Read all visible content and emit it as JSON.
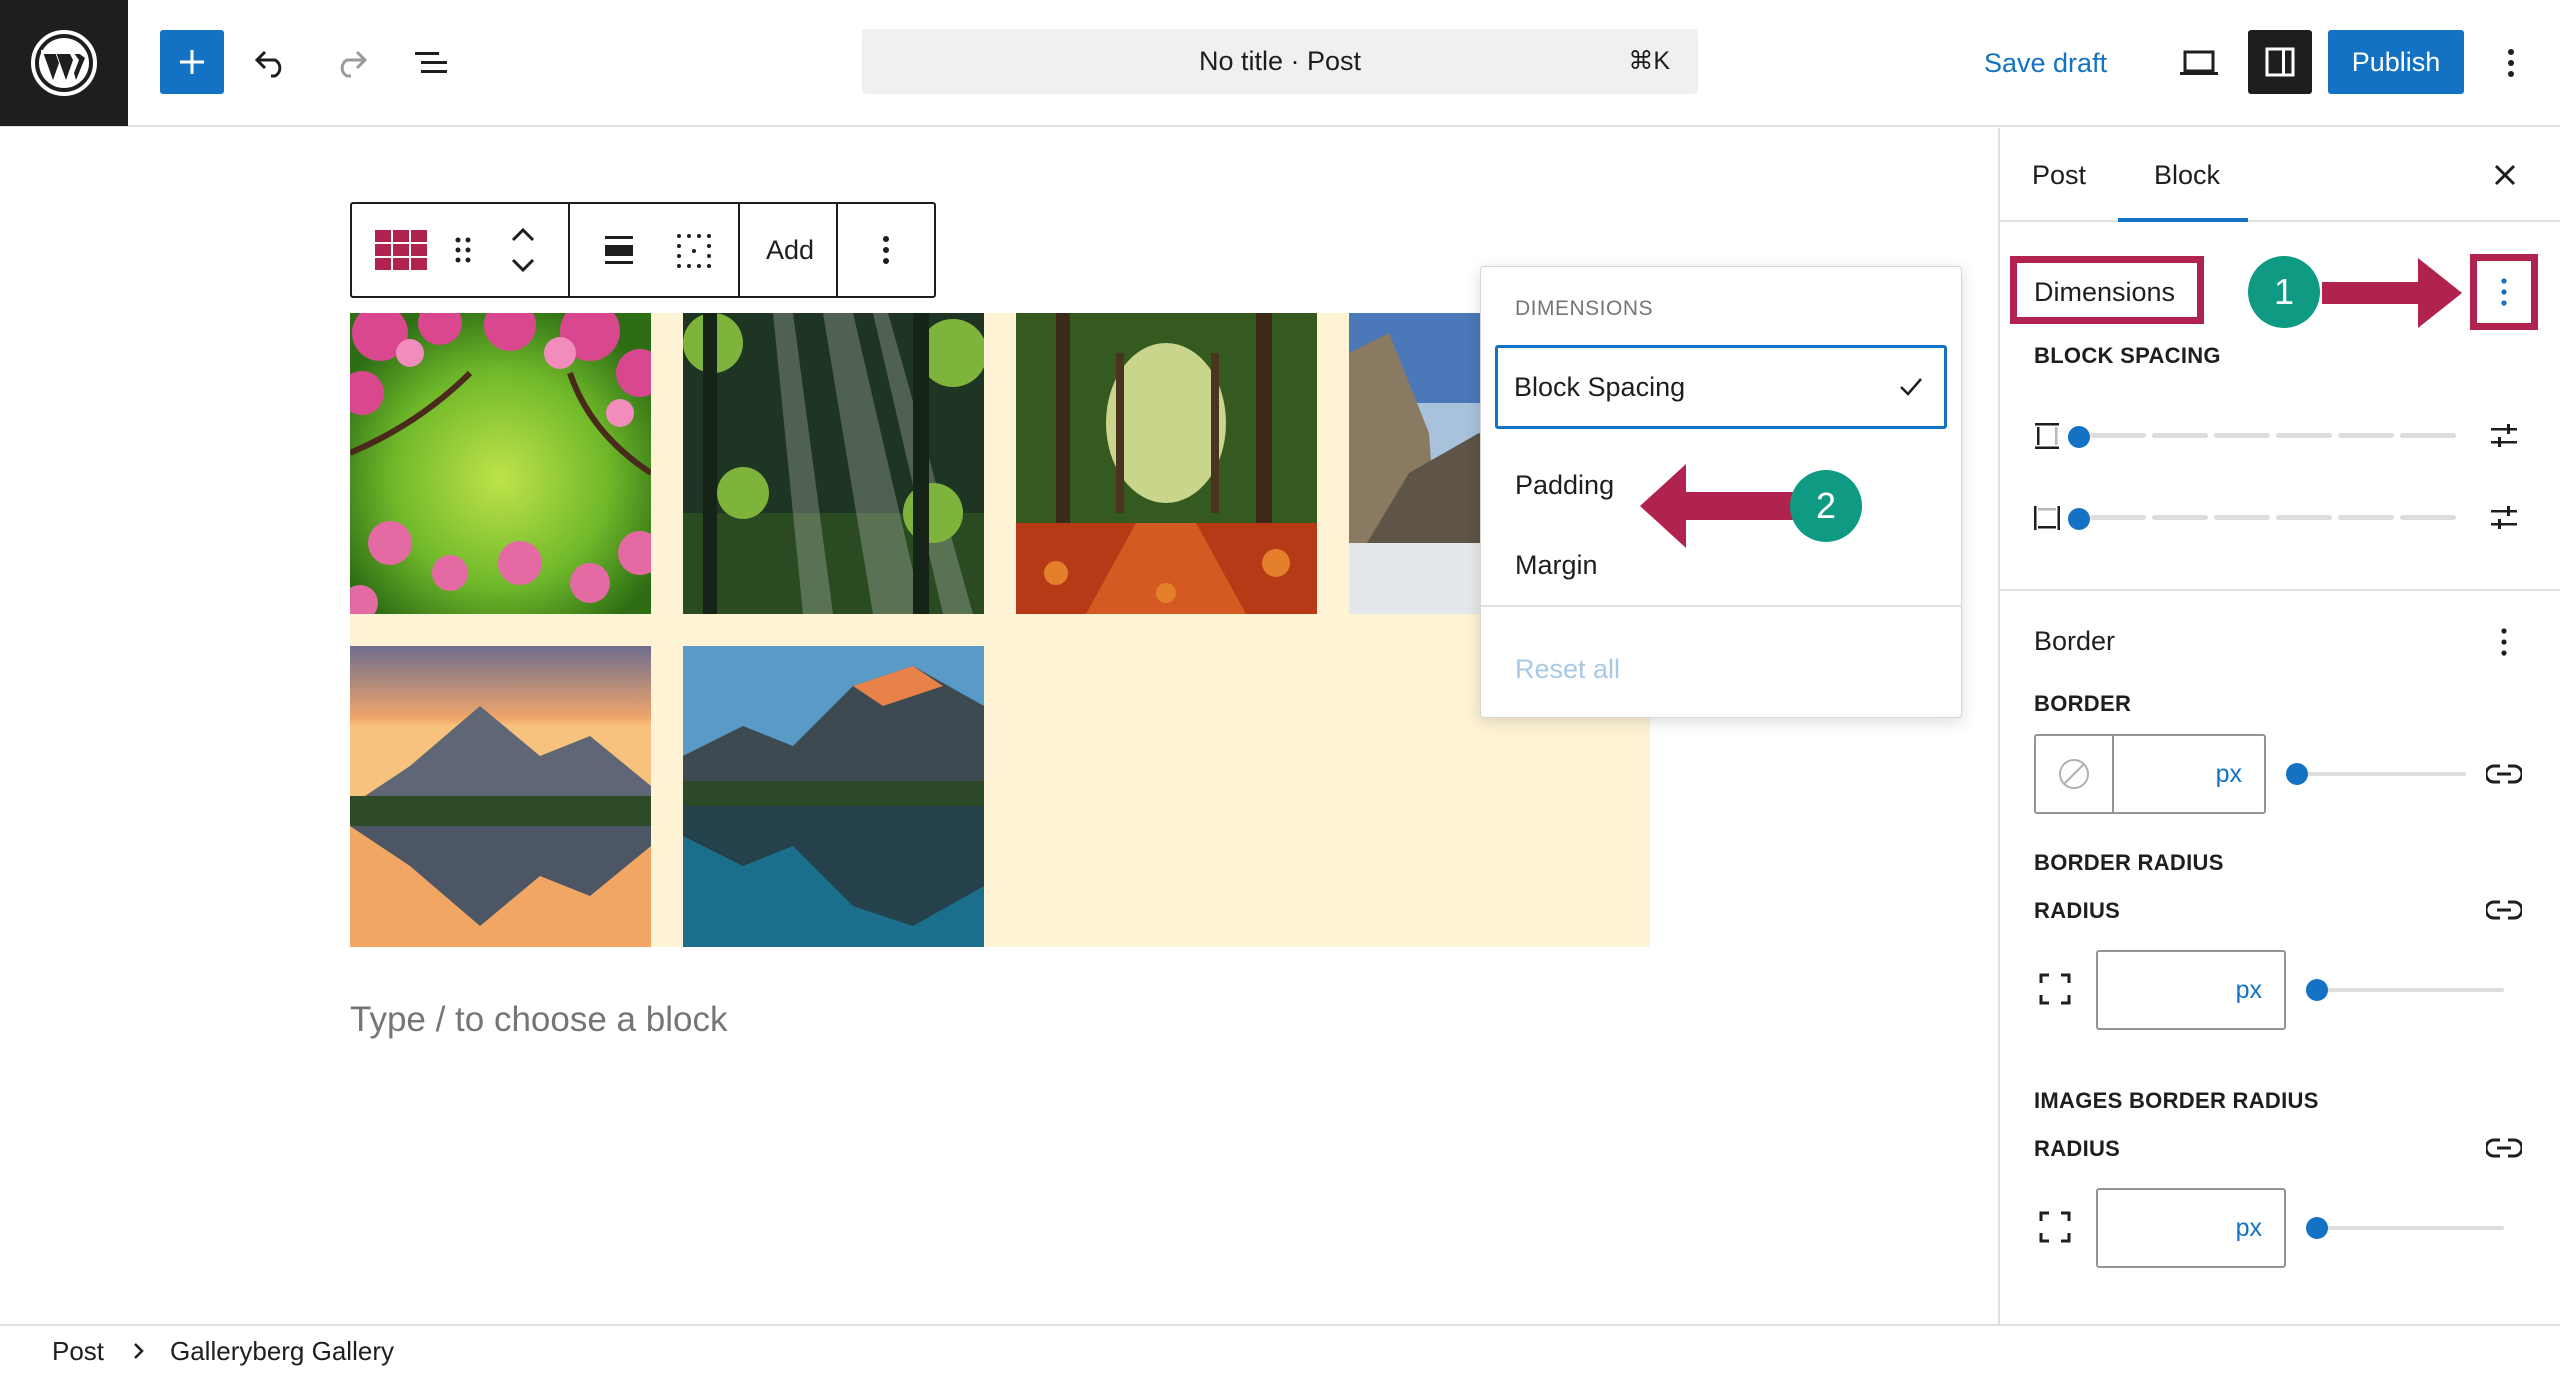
{
  "topbar": {
    "document_title": "No title · Post",
    "command_shortcut": "⌘K",
    "save_draft": "Save draft",
    "publish": "Publish",
    "colors": {
      "accent": "#1372c4",
      "dark": "#1e1e1e"
    }
  },
  "block_toolbar": {
    "add_label": "Add",
    "icons": [
      "gallery-block-icon",
      "drag-handle-icon",
      "move-up-icon",
      "move-down-icon",
      "align-icon",
      "grid-icon",
      "more-options-icon"
    ]
  },
  "canvas": {
    "gallery_images": [
      "pink-blossoms-photo",
      "forest-sunbeams-photo",
      "autumn-forest-path-photo",
      "yosemite-cliff-photo",
      "mountain-lake-sunset-photo",
      "mountain-lake-reflection-photo"
    ],
    "gallery_background": "#fef3d4",
    "type_hint": "Type / to choose a block"
  },
  "dimensions_menu": {
    "title": "DIMENSIONS",
    "options": [
      {
        "label": "Block Spacing",
        "checked": true
      },
      {
        "label": "Padding",
        "checked": false
      },
      {
        "label": "Margin",
        "checked": false
      }
    ],
    "reset_all": "Reset all"
  },
  "sidebar": {
    "tabs": [
      "Post",
      "Block"
    ],
    "active_tab": "Block",
    "dimensions": {
      "title": "Dimensions",
      "block_spacing_label": "BLOCK SPACING"
    },
    "border": {
      "title": "Border",
      "border_label": "BORDER",
      "unit": "px",
      "border_radius_label": "BORDER RADIUS",
      "radius_label": "RADIUS",
      "images_border_radius_label": "IMAGES BORDER RADIUS",
      "images_radius_label": "RADIUS"
    }
  },
  "annotations": {
    "step1": "1",
    "step2": "2",
    "color": "#b0234f",
    "circle_color": "#0e9a83"
  },
  "breadcrumb": {
    "root": "Post",
    "current": "Galleryberg Gallery"
  }
}
